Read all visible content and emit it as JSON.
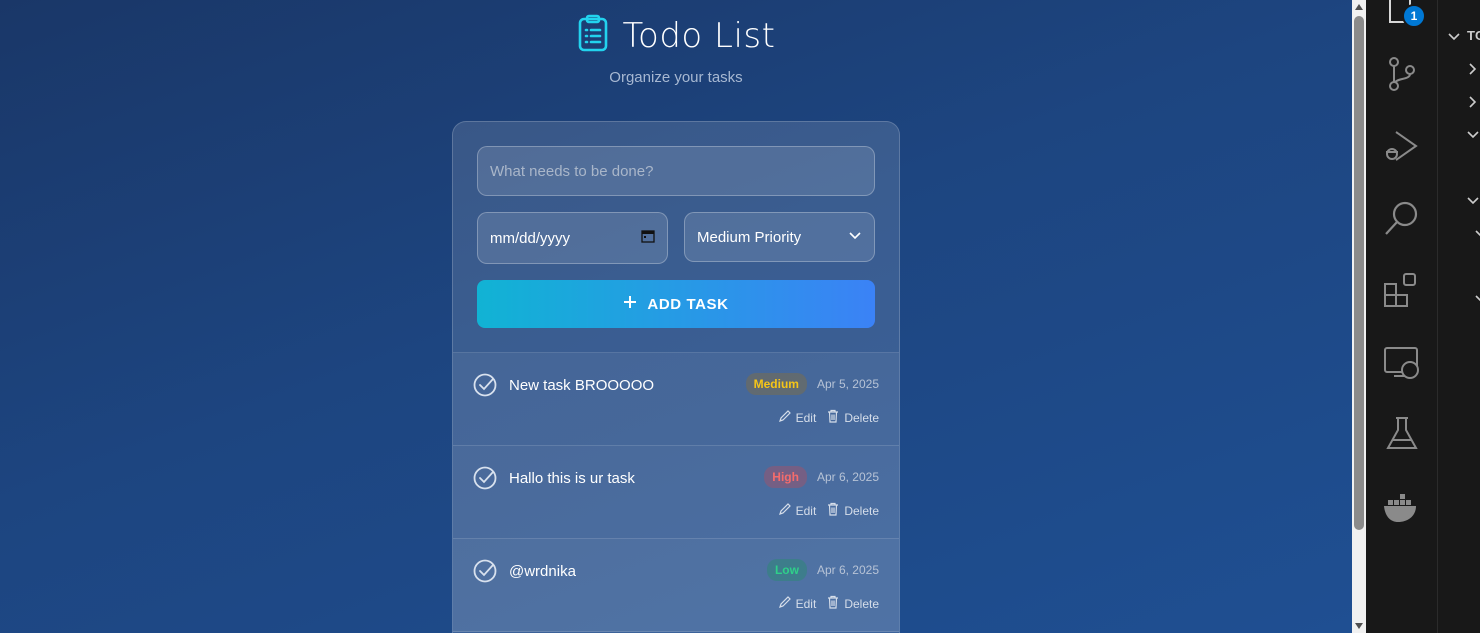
{
  "header": {
    "title": "Todo List",
    "subtitle": "Organize your tasks",
    "icon": "clipboard-list-icon",
    "accent": "#22d3ee"
  },
  "form": {
    "task_placeholder": "What needs to be done?",
    "task_value": "",
    "date_placeholder": "mm/dd/yyyy",
    "priority_selected": "Medium Priority",
    "add_button_label": "ADD TASK"
  },
  "tasks": [
    {
      "text": "New task BROOOOO",
      "priority": "Medium",
      "date": "Apr 5, 2025",
      "edit_label": "Edit",
      "delete_label": "Delete"
    },
    {
      "text": "Hallo this is ur task",
      "priority": "High",
      "date": "Apr 6, 2025",
      "edit_label": "Edit",
      "delete_label": "Delete"
    },
    {
      "text": "@wrdnika",
      "priority": "Low",
      "date": "Apr 6, 2025",
      "edit_label": "Edit",
      "delete_label": "Delete"
    }
  ],
  "priority_colors": {
    "Medium": "#f5c518",
    "High": "#f46c6c",
    "Low": "#2fd08a"
  },
  "activity_bar": {
    "icons": [
      "explorer-icon",
      "source-control-icon",
      "run-debug-icon",
      "search-icon",
      "extensions-icon",
      "remote-explorer-icon",
      "testing-icon",
      "docker-icon"
    ],
    "notification_count": "1"
  },
  "explorer": {
    "header_text": "TC"
  }
}
